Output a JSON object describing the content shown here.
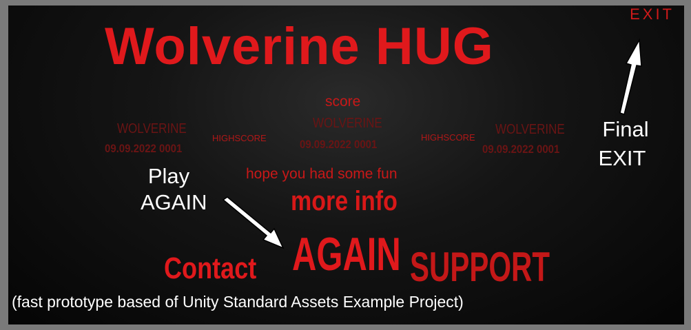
{
  "title": "Wolverine HUG",
  "exit_label": "EXIT",
  "score_label": "score",
  "highscores": [
    {
      "name": "WOLVERINE",
      "date": "09.09.2022 0001"
    },
    {
      "name": "WOLVERINE",
      "date": "09.09.2022 0001"
    },
    {
      "name": "WOLVERINE",
      "date": "09.09.2022 0001"
    }
  ],
  "highscore_label": "HIGHSCORE",
  "annotations": {
    "play_again_line1": "Play",
    "play_again_line2": "AGAIN",
    "final_exit_line1": "Final",
    "final_exit_line2": "EXIT"
  },
  "message": "hope you had some fun",
  "buttons": {
    "more_info": "more info",
    "again": "AGAIN",
    "support": "SUPPORT",
    "contact": "Contact"
  },
  "footer": "(fast prototype based of Unity Standard Assets Example Project)",
  "colors": {
    "accent_red": "#e0191c",
    "dim_red": "#6a1414",
    "background": "#050505",
    "border_gray": "#7a7a7a"
  }
}
